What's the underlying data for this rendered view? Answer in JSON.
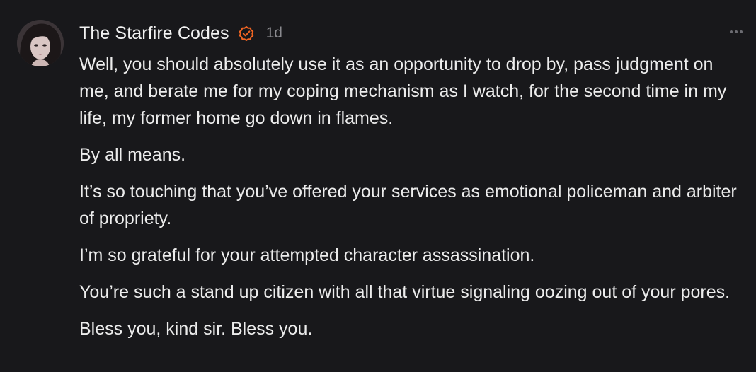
{
  "post": {
    "author": "The Starfire Codes",
    "timestamp": "1d",
    "paragraphs": [
      "Well, you should absolutely use it as an opportunity to drop by, pass judgment on me, and berate me for my coping mechanism as I watch, for the second time in my life, my former home go down in flames.",
      "By all means.",
      "It’s so touching that you’ve offered your services as emotional policeman and arbiter of propriety.",
      "I’m so grateful for your attempted character assassination.",
      "You’re such a stand up citizen with all that virtue signaling oozing out of your pores.",
      "Bless you, kind sir. Bless you."
    ]
  },
  "icons": {
    "verified": "verified-check-icon",
    "more": "more-options-icon"
  },
  "colors": {
    "background": "#18181b",
    "text": "#ececec",
    "muted": "#8a8a8f",
    "verified_accent": "#f26522"
  }
}
